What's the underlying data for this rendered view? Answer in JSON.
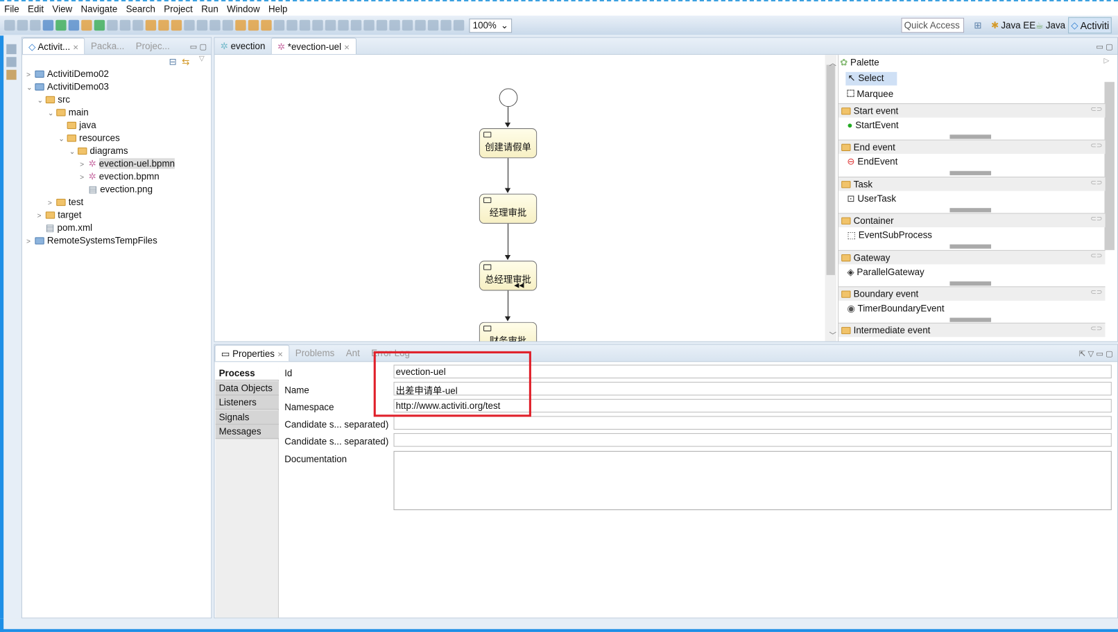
{
  "menu": [
    "File",
    "Edit",
    "View",
    "Navigate",
    "Search",
    "Project",
    "Run",
    "Window",
    "Help"
  ],
  "toolbar": {
    "zoom": "100%",
    "quick_access_placeholder": "Quick Access"
  },
  "perspectives": [
    "Java EE",
    "Java",
    "Activiti"
  ],
  "left_panel": {
    "tabs": [
      "Activit...",
      "Packa...",
      "Projec..."
    ],
    "tree": [
      {
        "label": "ActivitiDemo02",
        "depth": 0,
        "toggle": ">",
        "type": "project"
      },
      {
        "label": "ActivitiDemo03",
        "depth": 0,
        "toggle": "v",
        "type": "project"
      },
      {
        "label": "src",
        "depth": 1,
        "toggle": "v",
        "type": "folder"
      },
      {
        "label": "main",
        "depth": 2,
        "toggle": "v",
        "type": "folder"
      },
      {
        "label": "java",
        "depth": 3,
        "toggle": "",
        "type": "folder"
      },
      {
        "label": "resources",
        "depth": 3,
        "toggle": "v",
        "type": "folder"
      },
      {
        "label": "diagrams",
        "depth": 4,
        "toggle": "v",
        "type": "folder"
      },
      {
        "label": "evection-uel.bpmn",
        "depth": 5,
        "toggle": ">",
        "type": "bpmn",
        "selected": true
      },
      {
        "label": "evection.bpmn",
        "depth": 5,
        "toggle": ">",
        "type": "bpmn"
      },
      {
        "label": "evection.png",
        "depth": 5,
        "toggle": "",
        "type": "file"
      },
      {
        "label": "test",
        "depth": 2,
        "toggle": ">",
        "type": "folder"
      },
      {
        "label": "target",
        "depth": 1,
        "toggle": ">",
        "type": "folder"
      },
      {
        "label": "pom.xml",
        "depth": 1,
        "toggle": "",
        "type": "file"
      },
      {
        "label": "RemoteSystemsTempFiles",
        "depth": 0,
        "toggle": ">",
        "type": "project"
      }
    ]
  },
  "editor": {
    "tabs": [
      "evection",
      "*evection-uel"
    ],
    "nodes": [
      "创建请假单",
      "经理审批",
      "总经理审批",
      "财务审批"
    ]
  },
  "palette": {
    "title": "Palette",
    "tools": [
      "Select",
      "Marquee"
    ],
    "groups": [
      {
        "name": "Start event",
        "item": "StartEvent"
      },
      {
        "name": "End event",
        "item": "EndEvent"
      },
      {
        "name": "Task",
        "item": "UserTask"
      },
      {
        "name": "Container",
        "item": "EventSubProcess"
      },
      {
        "name": "Gateway",
        "item": "ParallelGateway"
      },
      {
        "name": "Boundary event",
        "item": "TimerBoundaryEvent"
      },
      {
        "name": "Intermediate event",
        "item": ""
      }
    ]
  },
  "properties": {
    "tabs": [
      "Properties",
      "Problems",
      "Ant",
      "Error Log"
    ],
    "side_tabs": [
      "Process",
      "Data Objects",
      "Listeners",
      "Signals",
      "Messages"
    ],
    "fields": [
      {
        "label": "Id",
        "value": "evection-uel"
      },
      {
        "label": "Name",
        "value": "出差申请单-uel"
      },
      {
        "label": "Namespace",
        "value": "http://www.activiti.org/test"
      },
      {
        "label": "Candidate s... separated)",
        "value": ""
      },
      {
        "label": "Candidate s... separated)",
        "value": ""
      }
    ],
    "documentation_label": "Documentation",
    "documentation": ""
  },
  "colors": {
    "highlight_box": "#e0202a",
    "accent": "#1f8fe6"
  }
}
